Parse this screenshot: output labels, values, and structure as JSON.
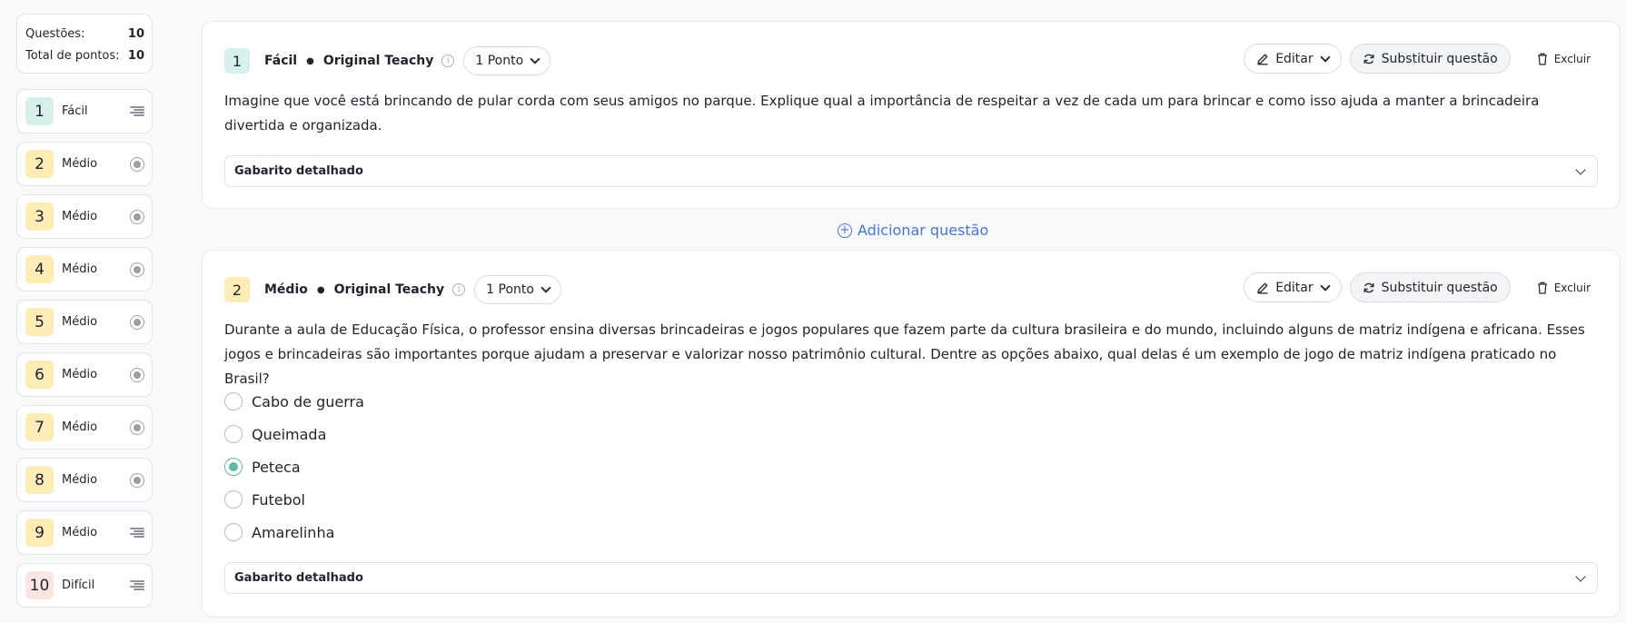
{
  "summary": {
    "questions_label": "Questões:",
    "questions_value": "10",
    "points_label": "Total de pontos:",
    "points_value": "10"
  },
  "nav": [
    {
      "num": "1",
      "label": "Fácil",
      "color": "#d7f0ee",
      "icon": "lines-icon"
    },
    {
      "num": "2",
      "label": "Médio",
      "color": "#fdecb5",
      "icon": "radio-icon"
    },
    {
      "num": "3",
      "label": "Médio",
      "color": "#fdecb5",
      "icon": "radio-icon"
    },
    {
      "num": "4",
      "label": "Médio",
      "color": "#fdecb5",
      "icon": "radio-icon"
    },
    {
      "num": "5",
      "label": "Médio",
      "color": "#fdecb5",
      "icon": "radio-icon"
    },
    {
      "num": "6",
      "label": "Médio",
      "color": "#fdecb5",
      "icon": "radio-icon"
    },
    {
      "num": "7",
      "label": "Médio",
      "color": "#fdecb5",
      "icon": "radio-icon"
    },
    {
      "num": "8",
      "label": "Médio",
      "color": "#fdecb5",
      "icon": "radio-icon"
    },
    {
      "num": "9",
      "label": "Médio",
      "color": "#fdecb5",
      "icon": "lines-icon"
    },
    {
      "num": "10",
      "label": "Difícil",
      "color": "#fde6e2",
      "icon": "lines-icon"
    }
  ],
  "q1": {
    "num": "1",
    "difficulty": "Fácil",
    "source": "Original Teachy",
    "points": "1 Ponto",
    "text": "Imagine que você está brincando de pular corda com seus amigos no parque. Explique qual a importância de respeitar a vez de cada um para brincar e como isso ajuda a manter a brincadeira divertida e organizada.",
    "gabarito": "Gabarito detalhado"
  },
  "q2": {
    "num": "2",
    "difficulty": "Médio",
    "source": "Original Teachy",
    "points": "1 Ponto",
    "text": "Durante a aula de Educação Física, o professor ensina diversas brincadeiras e jogos populares que fazem parte da cultura brasileira e do mundo, incluindo alguns de matriz indígena e africana. Esses jogos e brincadeiras são importantes porque ajudam a preservar e valorizar nosso patrimônio cultural. Dentre as opções abaixo, qual delas é um exemplo de jogo de matriz indígena praticado no Brasil?",
    "options": [
      "Cabo de guerra",
      "Queimada",
      "Peteca",
      "Futebol",
      "Amarelinha"
    ],
    "selected_option": "Peteca",
    "gabarito": "Gabarito detalhado"
  },
  "actions": {
    "edit": "Editar",
    "replace": "Substituir questão",
    "delete": "Excluir"
  },
  "add_question": "Adicionar questão",
  "colors": {
    "easy_badge": "#d7f0ee",
    "medium_badge": "#fdecb5",
    "hard_badge": "#fde6e2",
    "accent_blue": "#4a72d8",
    "selected_radio": "#5fb9a8"
  }
}
